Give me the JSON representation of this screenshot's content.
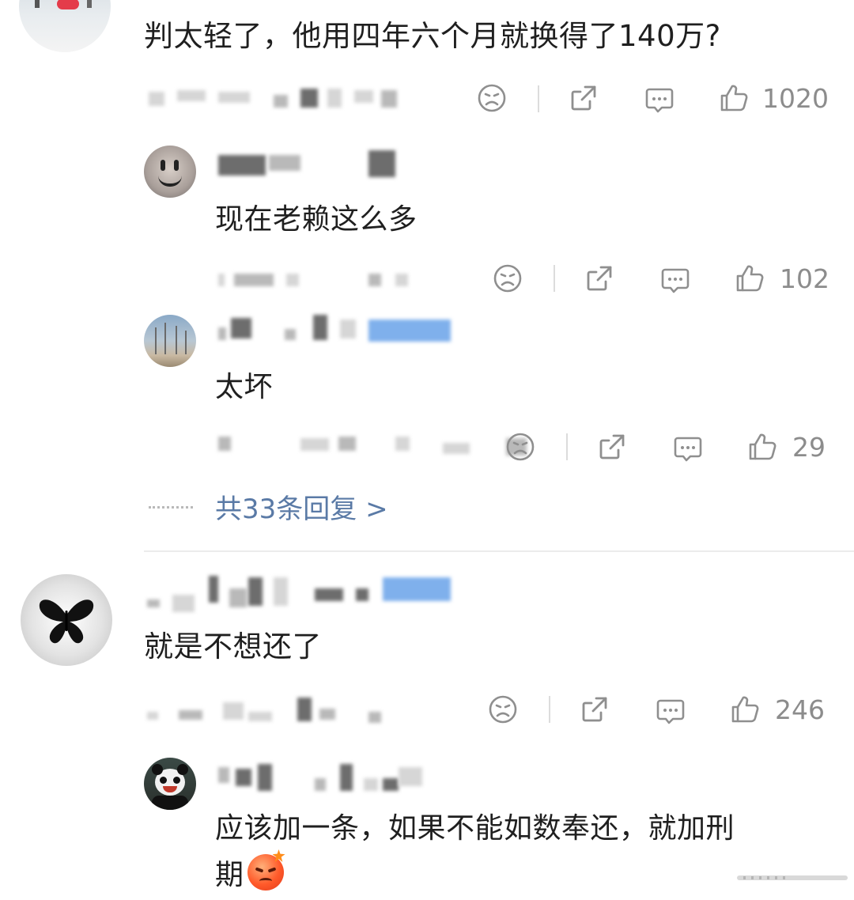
{
  "comments": [
    {
      "text": "判太轻了，他用四年六个月就换得了140万?",
      "likes": "1020",
      "avatar_icon": "skier-photo-avatar",
      "replies": [
        {
          "text": "现在老赖这么多",
          "likes": "102",
          "avatar_icon": "smiley-face-avatar"
        },
        {
          "text": "太坏",
          "likes": "29",
          "avatar_icon": "landscape-avatar"
        }
      ],
      "more_replies_label": "共33条回复 >"
    },
    {
      "text": "就是不想还了",
      "likes": "246",
      "avatar_icon": "black-butterfly-avatar",
      "replies": [
        {
          "text_line1": "应该加一条，如果不能如数奉还，就加刑",
          "text_line2": "期",
          "likes": "",
          "avatar_icon": "panda-avatar",
          "emoji": "angry-face-emoji"
        }
      ]
    }
  ],
  "action_icons": [
    "dislike-face-icon",
    "share-icon",
    "comment-icon",
    "thumbs-up-icon"
  ],
  "colors": {
    "link": "#5a7aa6",
    "count": "#8c8c8c",
    "icon": "#9a9a9a",
    "divider": "#ececec"
  }
}
